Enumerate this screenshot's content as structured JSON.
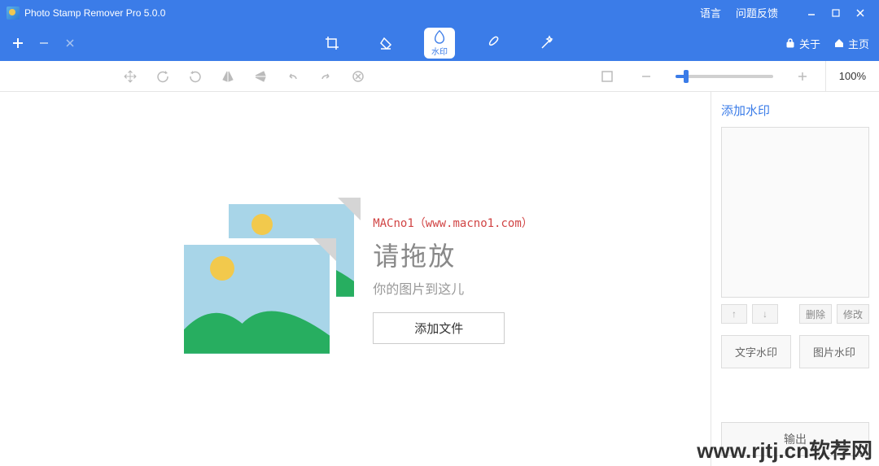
{
  "titlebar": {
    "app_title": "Photo Stamp Remover Pro 5.0.0",
    "language_link": "语言",
    "feedback_link": "问题反馈"
  },
  "toolbar": {
    "watermark_label": "水印",
    "about_label": "关于",
    "home_label": "主页"
  },
  "secondary": {
    "zoom_value": "100%"
  },
  "canvas": {
    "watermark_overlay": "MACno1（www.macno1.com）",
    "drop_title": "请拖放",
    "drop_subtitle": "你的图片到这儿",
    "add_file_button": "添加文件"
  },
  "sidebar": {
    "title": "添加水印",
    "delete_btn": "删除",
    "modify_btn": "修改",
    "text_wm_btn": "文字水印",
    "image_wm_btn": "图片水印",
    "export_btn": "输出"
  },
  "site_watermark": "www.rjtj.cn软荐网"
}
